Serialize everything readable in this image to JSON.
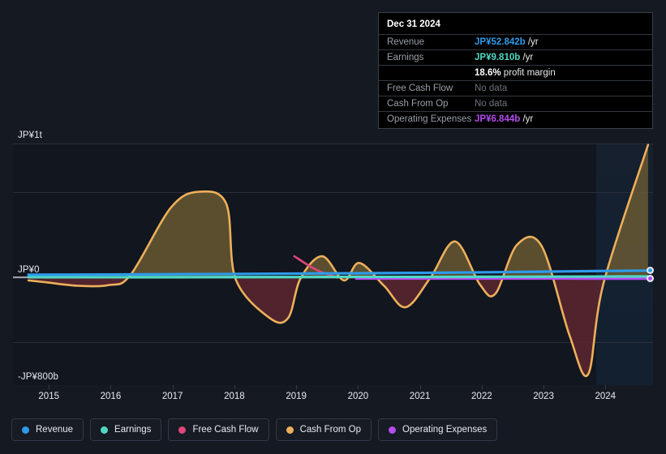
{
  "chart_data": {
    "type": "area",
    "title": "",
    "xlabel": "",
    "ylabel": "",
    "currency": "JP¥",
    "ylim": [
      -800,
      1000
    ],
    "y_unit": "billions JP¥",
    "grid": true,
    "legend_position": "bottom",
    "y_ticks": [
      {
        "label": "JP¥1t",
        "value": 1000
      },
      {
        "label": "JP¥0",
        "value": 0
      },
      {
        "label": "-JP¥800b",
        "value": -800
      }
    ],
    "gridline_values": [
      1000,
      640,
      0,
      -480
    ],
    "x_ticks": [
      "2015",
      "2016",
      "2017",
      "2018",
      "2019",
      "2020",
      "2021",
      "2022",
      "2023",
      "2024"
    ],
    "x_range": [
      2014.45,
      2024.8
    ],
    "forecast_region_start": "2024",
    "series": [
      {
        "name": "Revenue",
        "color": "#2e9bea",
        "x": [
          2014.7,
          2016,
          2017,
          2018,
          2019,
          2020,
          2021,
          2022,
          2023,
          2024,
          2024.75
        ],
        "values": [
          22,
          24,
          26,
          28,
          31,
          33,
          36,
          40,
          45,
          50,
          52.842
        ]
      },
      {
        "name": "Earnings",
        "color": "#4fd9c4",
        "x": [
          2014.7,
          2016,
          2017,
          2018,
          2019,
          2020,
          2021,
          2022,
          2023,
          2024,
          2024.75
        ],
        "values": [
          4,
          4,
          4,
          5,
          5,
          6,
          6,
          7,
          8,
          9,
          9.81
        ]
      },
      {
        "name": "Free Cash Flow",
        "color": "#e0467c",
        "x": [
          2019.0,
          2019.35,
          2019.7
        ],
        "values": [
          160,
          60,
          0
        ],
        "note": "No data"
      },
      {
        "name": "Cash From Op",
        "color": "#eeb05a",
        "x": [
          2014.7,
          2015.0,
          2015.5,
          2016.0,
          2016.35,
          2017.0,
          2017.45,
          2017.9,
          2018.05,
          2018.6,
          2018.9,
          2019.1,
          2019.45,
          2019.8,
          2020.05,
          2020.45,
          2020.8,
          2021.2,
          2021.6,
          2022.0,
          2022.25,
          2022.6,
          2023.0,
          2023.45,
          2023.75,
          2024.0,
          2024.72
        ],
        "values": [
          -20,
          -35,
          -60,
          -55,
          20,
          520,
          640,
          550,
          -10,
          -300,
          -300,
          -5,
          160,
          -20,
          110,
          -60,
          -220,
          0,
          270,
          -50,
          -120,
          245,
          235,
          -430,
          -720,
          -40,
          990
        ],
        "note": "No data"
      },
      {
        "name": "Operating Expenses",
        "color": "#b44cf0",
        "x": [
          2020.0,
          2021,
          2022,
          2023,
          2024,
          2024.75
        ],
        "values": [
          -6,
          -6,
          -6,
          -6,
          -6.5,
          -6.844
        ]
      }
    ]
  },
  "tooltip": {
    "title": "Dec 31 2024",
    "rows": [
      {
        "label": "Revenue",
        "value": "JP¥52.842b",
        "unit": " /yr",
        "color": "#2e9bea",
        "nodata": false
      },
      {
        "label": "Earnings",
        "value": "JP¥9.810b",
        "unit": " /yr",
        "color": "#4fd9c4",
        "nodata": false
      },
      {
        "label": "",
        "value": "18.6%",
        "unit": " profit margin",
        "color": "#ffffff",
        "nodata": false
      },
      {
        "label": "Free Cash Flow",
        "value": "No data",
        "unit": "",
        "color": "#6d727c",
        "nodata": true
      },
      {
        "label": "Cash From Op",
        "value": "No data",
        "unit": "",
        "color": "#6d727c",
        "nodata": true
      },
      {
        "label": "Operating Expenses",
        "value": "JP¥6.844b",
        "unit": " /yr",
        "color": "#b44cf0",
        "nodata": false
      }
    ]
  },
  "legend": {
    "items": [
      {
        "label": "Revenue",
        "color": "#2e9bea"
      },
      {
        "label": "Earnings",
        "color": "#4fd9c4"
      },
      {
        "label": "Free Cash Flow",
        "color": "#e0467c"
      },
      {
        "label": "Cash From Op",
        "color": "#eeb05a"
      },
      {
        "label": "Operating Expenses",
        "color": "#b44cf0"
      }
    ]
  },
  "colors": {
    "background": "#151922",
    "plot_background": "#12161f",
    "grid": "#2a2f3a",
    "text": "#e8eaee",
    "muted": "#9b9fa8"
  }
}
